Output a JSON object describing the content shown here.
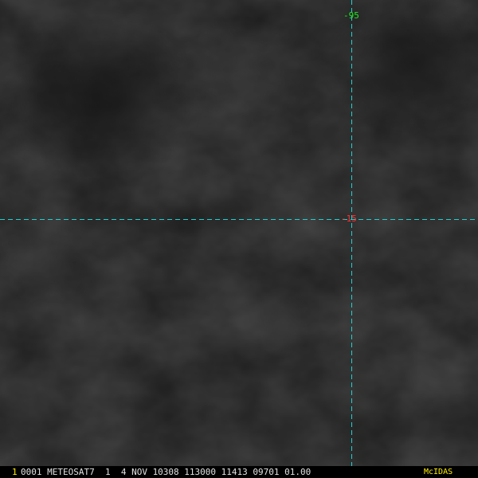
{
  "overlay": {
    "longitude_label": "-95",
    "latitude_label": "-15",
    "grid_color": "#22d0d0",
    "longitude_label_color": "#22e622",
    "latitude_label_color": "#ff3030"
  },
  "status_bar": {
    "frame_number": "1",
    "text": "0001 METEOSAT7  1  4 NOV 10308 113000 11413 09701 01.00",
    "brand": "McIDAS",
    "frame_color": "#ffee00",
    "brand_color": "#ffee00"
  }
}
